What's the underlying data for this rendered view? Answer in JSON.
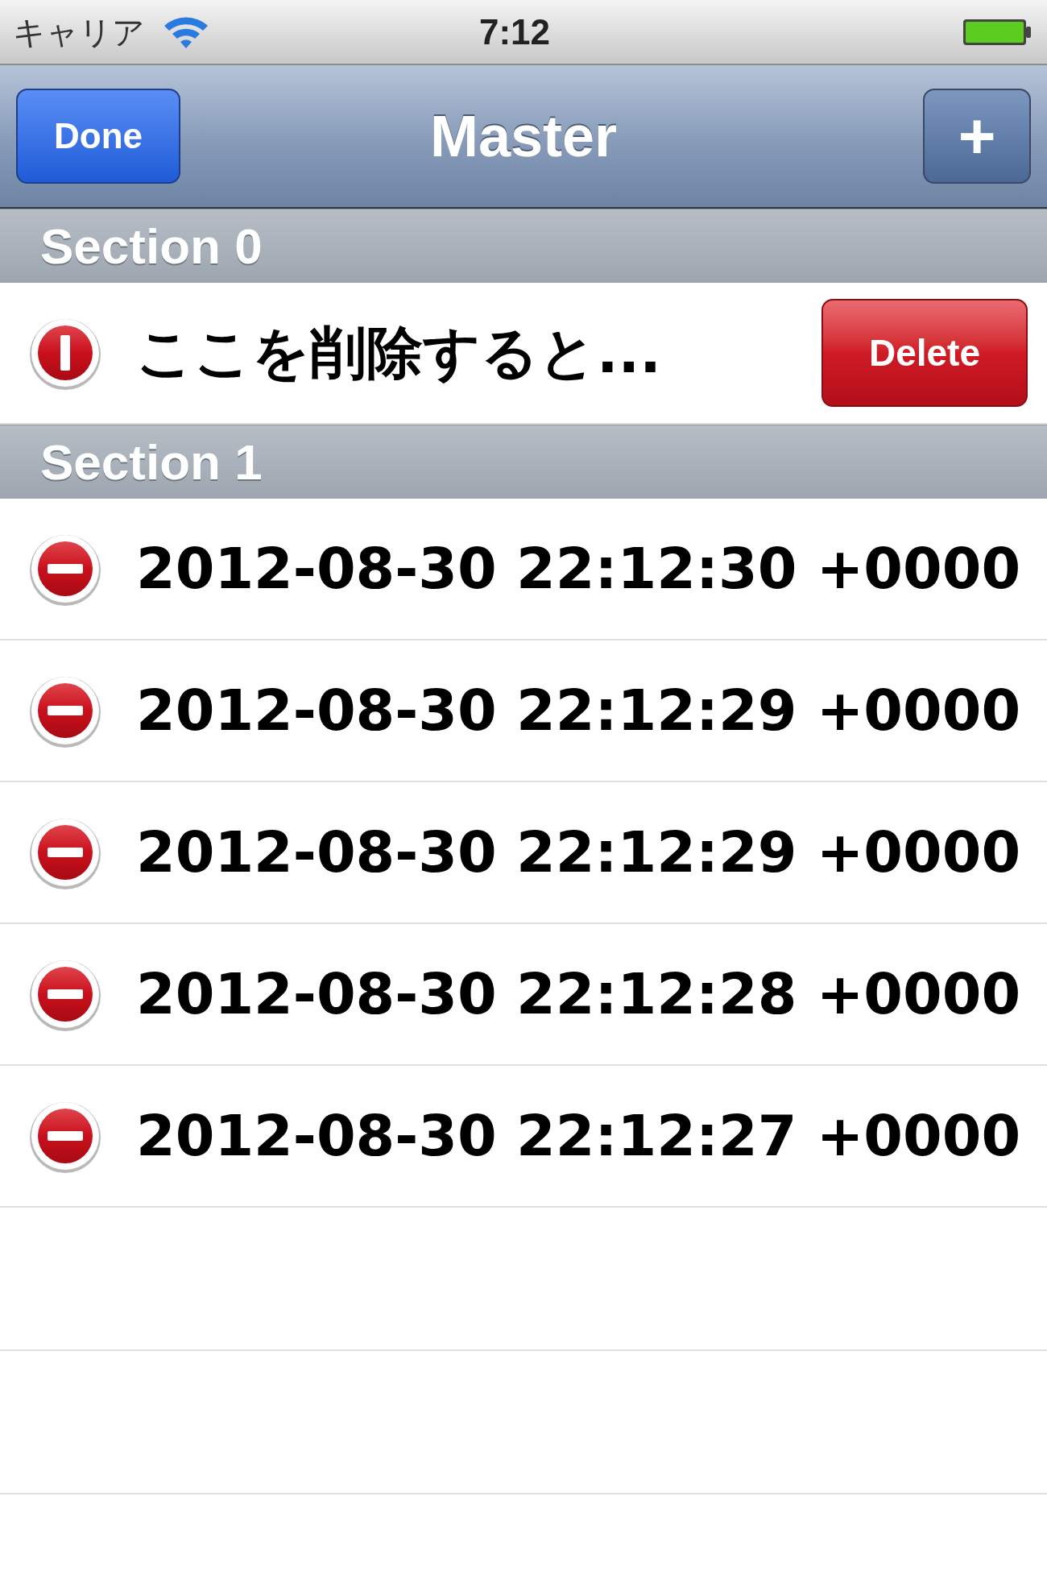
{
  "status_bar": {
    "carrier": "キャリア",
    "time": "7:12"
  },
  "nav_bar": {
    "left_button": "Done",
    "title": "Master",
    "right_button": "+"
  },
  "sections": [
    {
      "title": "Section 0",
      "rows": [
        {
          "text": "ここを削除すると...",
          "deleting": true,
          "delete_label": "Delete"
        }
      ]
    },
    {
      "title": "Section 1",
      "rows": [
        {
          "text": "2012-08-30 22:12:30 +0000",
          "deleting": false
        },
        {
          "text": "2012-08-30 22:12:29 +0000",
          "deleting": false
        },
        {
          "text": "2012-08-30 22:12:29 +0000",
          "deleting": false
        },
        {
          "text": "2012-08-30 22:12:28 +0000",
          "deleting": false
        },
        {
          "text": "2012-08-30 22:12:27 +0000",
          "deleting": false
        }
      ]
    }
  ]
}
